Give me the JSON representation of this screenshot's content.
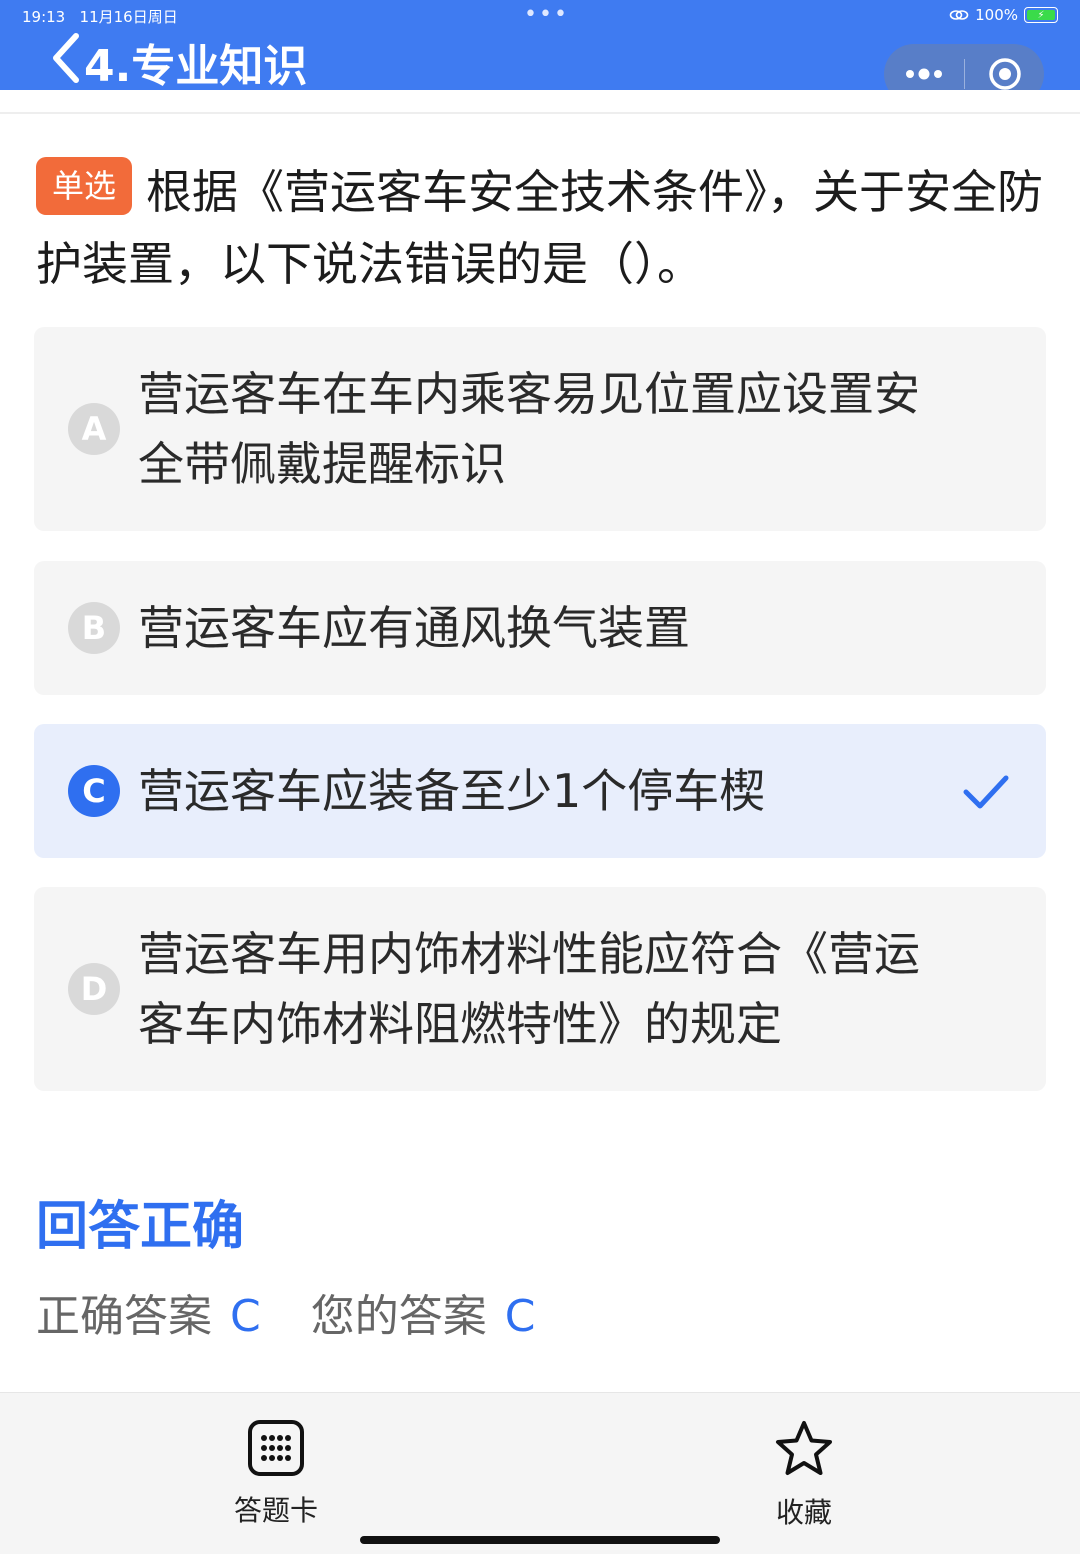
{
  "status": {
    "time": "19:13",
    "date": "11月16日周日",
    "battery": "100%"
  },
  "header": {
    "title": "4.专业知识"
  },
  "question": {
    "type_tag": "单选",
    "text": "根据《营运客车安全技术条件》，关于安全防护装置，以下说法错误的是（）。"
  },
  "options": [
    {
      "letter": "A",
      "text": "营运客车在车内乘客易见位置应设置安全带佩戴提醒标识",
      "selected": false
    },
    {
      "letter": "B",
      "text": "营运客车应有通风换气装置",
      "selected": false
    },
    {
      "letter": "C",
      "text": "营运客车应装备至少1个停车楔",
      "selected": true
    },
    {
      "letter": "D",
      "text": "营运客车用内饰材料性能应符合《营运客车内饰材料阻燃特性》的规定",
      "selected": false
    }
  ],
  "result": {
    "title": "回答正确",
    "correct_label": "正确答案",
    "correct_value": "C",
    "yours_label": "您的答案",
    "yours_value": "C"
  },
  "bottom_bar": {
    "card_label": "答题卡",
    "favorite_label": "收藏"
  },
  "colors": {
    "header_bg": "#3f7bf1",
    "accent": "#2f6ff0",
    "tag": "#f26b3a"
  }
}
